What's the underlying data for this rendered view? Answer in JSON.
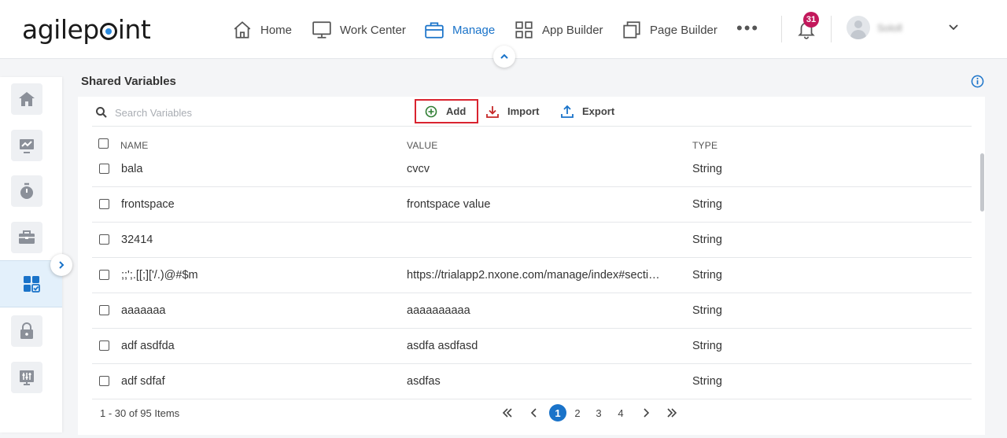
{
  "header": {
    "logo": {
      "pre": "agilep",
      "post": "int"
    },
    "nav": [
      {
        "label": "Home",
        "icon": "home-icon"
      },
      {
        "label": "Work Center",
        "icon": "monitor-icon"
      },
      {
        "label": "Manage",
        "icon": "briefcase-icon",
        "active": true
      },
      {
        "label": "App Builder",
        "icon": "grid-icon"
      },
      {
        "label": "Page Builder",
        "icon": "pages-icon"
      }
    ],
    "more": "•••",
    "notifications": "31",
    "username": "Sololl"
  },
  "sidebar": {
    "items": [
      "home-icon",
      "analytics-icon",
      "timer-icon",
      "toolbox-icon",
      "dashboard-check-icon",
      "lock-icon",
      "settings-sliders-icon"
    ],
    "active_index": 4
  },
  "page": {
    "title": "Shared Variables"
  },
  "toolbar": {
    "search_placeholder": "Search Variables",
    "add_label": "Add",
    "import_label": "Import",
    "export_label": "Export"
  },
  "table": {
    "columns": [
      "NAME",
      "VALUE",
      "TYPE"
    ],
    "rows": [
      {
        "name": "bala",
        "value": "cvcv",
        "type": "String"
      },
      {
        "name": "frontspace",
        "value": "frontspace value",
        "type": "String"
      },
      {
        "name": "32414",
        "value": "",
        "type": "String"
      },
      {
        "name": ";;';.[[;]['/.)@#$m",
        "value": "https://trialapp2.nxone.com/manage/index#secti…",
        "type": "String"
      },
      {
        "name": "aaaaaaa",
        "value": "aaaaaaaaaa",
        "type": "String"
      },
      {
        "name": "adf asdfda",
        "value": "asdfa asdfasd",
        "type": "String"
      },
      {
        "name": "adf sdfaf",
        "value": "asdfas",
        "type": "String"
      }
    ]
  },
  "pagination": {
    "info": "1 - 30 of 95 Items",
    "pages": [
      "1",
      "2",
      "3",
      "4"
    ],
    "current": "1"
  },
  "colors": {
    "accent": "#1a73c9",
    "add_highlight": "#d9232f",
    "add_icon": "#2e7d32",
    "import_icon": "#c62828",
    "badge": "#c2185b"
  }
}
